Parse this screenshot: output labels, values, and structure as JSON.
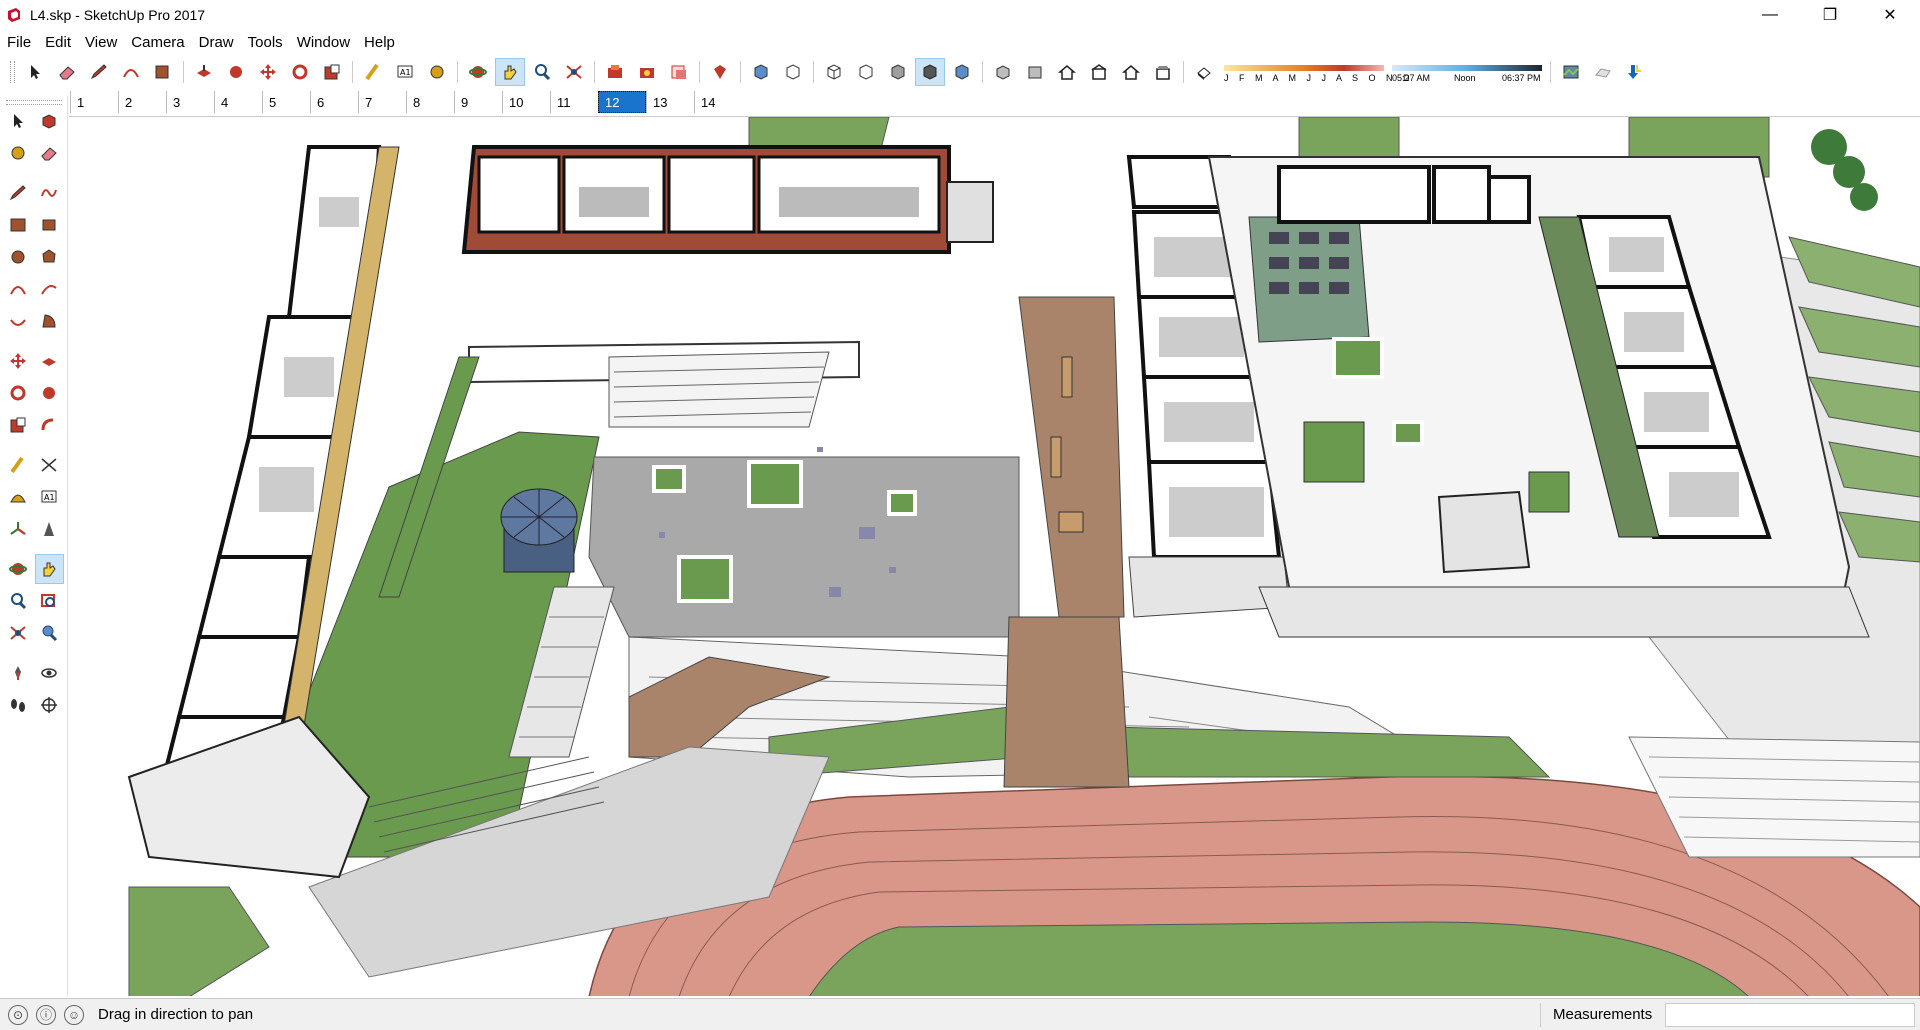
{
  "window": {
    "title": "L4.skp - SketchUp Pro 2017",
    "minimize_glyph": "—",
    "maximize_glyph": "❐",
    "close_glyph": "✕"
  },
  "menu": [
    "File",
    "Edit",
    "View",
    "Camera",
    "Draw",
    "Tools",
    "Window",
    "Help"
  ],
  "scenes": {
    "tabs": [
      "1",
      "2",
      "3",
      "4",
      "5",
      "6",
      "7",
      "8",
      "9",
      "10",
      "11",
      "12",
      "13",
      "14"
    ],
    "active": "12"
  },
  "shadows": {
    "months": "J F M A M J J A S O N D",
    "time_start": "05:27 AM",
    "time_mid": "Noon",
    "time_end": "06:37 PM"
  },
  "status": {
    "hint": "Drag in direction to pan",
    "measurements_label": "Measurements",
    "measurements_value": ""
  },
  "colors": {
    "grass": "#6a9a4e",
    "plaza": "#a9a9a9",
    "track": "#d8968a",
    "wood": "#a9846a",
    "brick": "#a04a38",
    "active_tab": "#1874cd"
  },
  "toolbar_icons": [
    "select-icon",
    "eraser-icon",
    "pencil-icon",
    "arc-icon",
    "paint-bucket-icon",
    "push-pull-icon",
    "follow-me-icon",
    "move-icon",
    "rotate-icon",
    "scale-icon",
    "tape-measure-icon",
    "text-icon",
    "paint-icon",
    "orbit-icon",
    "pan-icon",
    "zoom-icon",
    "zoom-extents-icon",
    "warehouse-icon",
    "extension-warehouse-icon",
    "send-to-layout-icon",
    "ruby-icon",
    "xray-icon",
    "back-edges-icon",
    "wireframe-icon",
    "hidden-line-icon",
    "shaded-icon",
    "shaded-textures-icon",
    "monochrome-icon",
    "iso-icon",
    "top-view-icon",
    "front-view-icon",
    "right-view-icon",
    "back-view-icon",
    "left-view-icon",
    "shadows-toggle-icon",
    "geo-location-icon",
    "sandbox-icon",
    "upload-icon"
  ]
}
